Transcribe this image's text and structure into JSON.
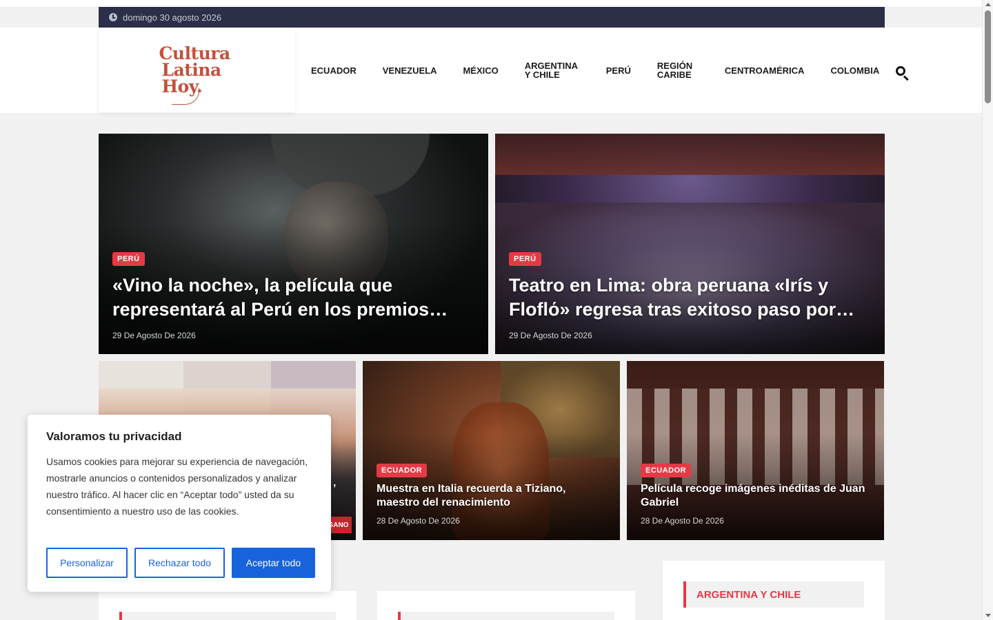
{
  "topbar": {
    "date": "domingo 30 agosto 2026"
  },
  "logo": {
    "line1": "Cultura",
    "line2": "Latina",
    "line3": "Hoy."
  },
  "nav": {
    "items": [
      "ECUADOR",
      "VENEZUELA",
      "MÉXICO",
      "ARGENTINA Y CHILE",
      "PERÚ",
      "REGIÓN CARIBE",
      "CENTROAMÉRICA",
      "COLOMBIA"
    ]
  },
  "featured": [
    {
      "category": "PERÚ",
      "title": "«Vino la noche», la película que representará al Perú en los premios…",
      "date": "29 De Agosto De 2026"
    },
    {
      "category": "PERÚ",
      "title": "Teatro en Lima: obra peruana «Irís y Floflό» regresa tras exitoso paso por…",
      "date": "29 De Agosto De 2026"
    }
  ],
  "secondary": [
    {
      "category": "",
      "title": "’",
      "date": "",
      "tag": "SANO"
    },
    {
      "category": "ECUADOR",
      "title": "Muestra en Italia recuerda a Tiziano, maestro del renacimiento",
      "date": "28 De Agosto De 2026"
    },
    {
      "category": "ECUADOR",
      "title": "Película recoge imágenes inéditas de Juan Gabriel",
      "date": "28 De Agosto De 2026"
    }
  ],
  "cookie": {
    "title": "Valoramos tu privacidad",
    "text": "Usamos cookies para mejorar su experiencia de navegación, mostrarle anuncios o contenidos personalizados y analizar nuestro tráfico. Al hacer clic en “Aceptar todo” usted da su consentimiento a nuestro uso de las cookies.",
    "customize": "Personalizar",
    "reject": "Rechazar todo",
    "accept": "Aceptar todo"
  },
  "sidebar": {
    "heading": "ARGENTINA Y CHILE"
  },
  "colors": {
    "accent": "#e63946",
    "topbar": "#2c2f48",
    "brand": "#c4513c",
    "button": "#1863dc"
  },
  "icons": [
    "clock-icon",
    "search-icon"
  ]
}
